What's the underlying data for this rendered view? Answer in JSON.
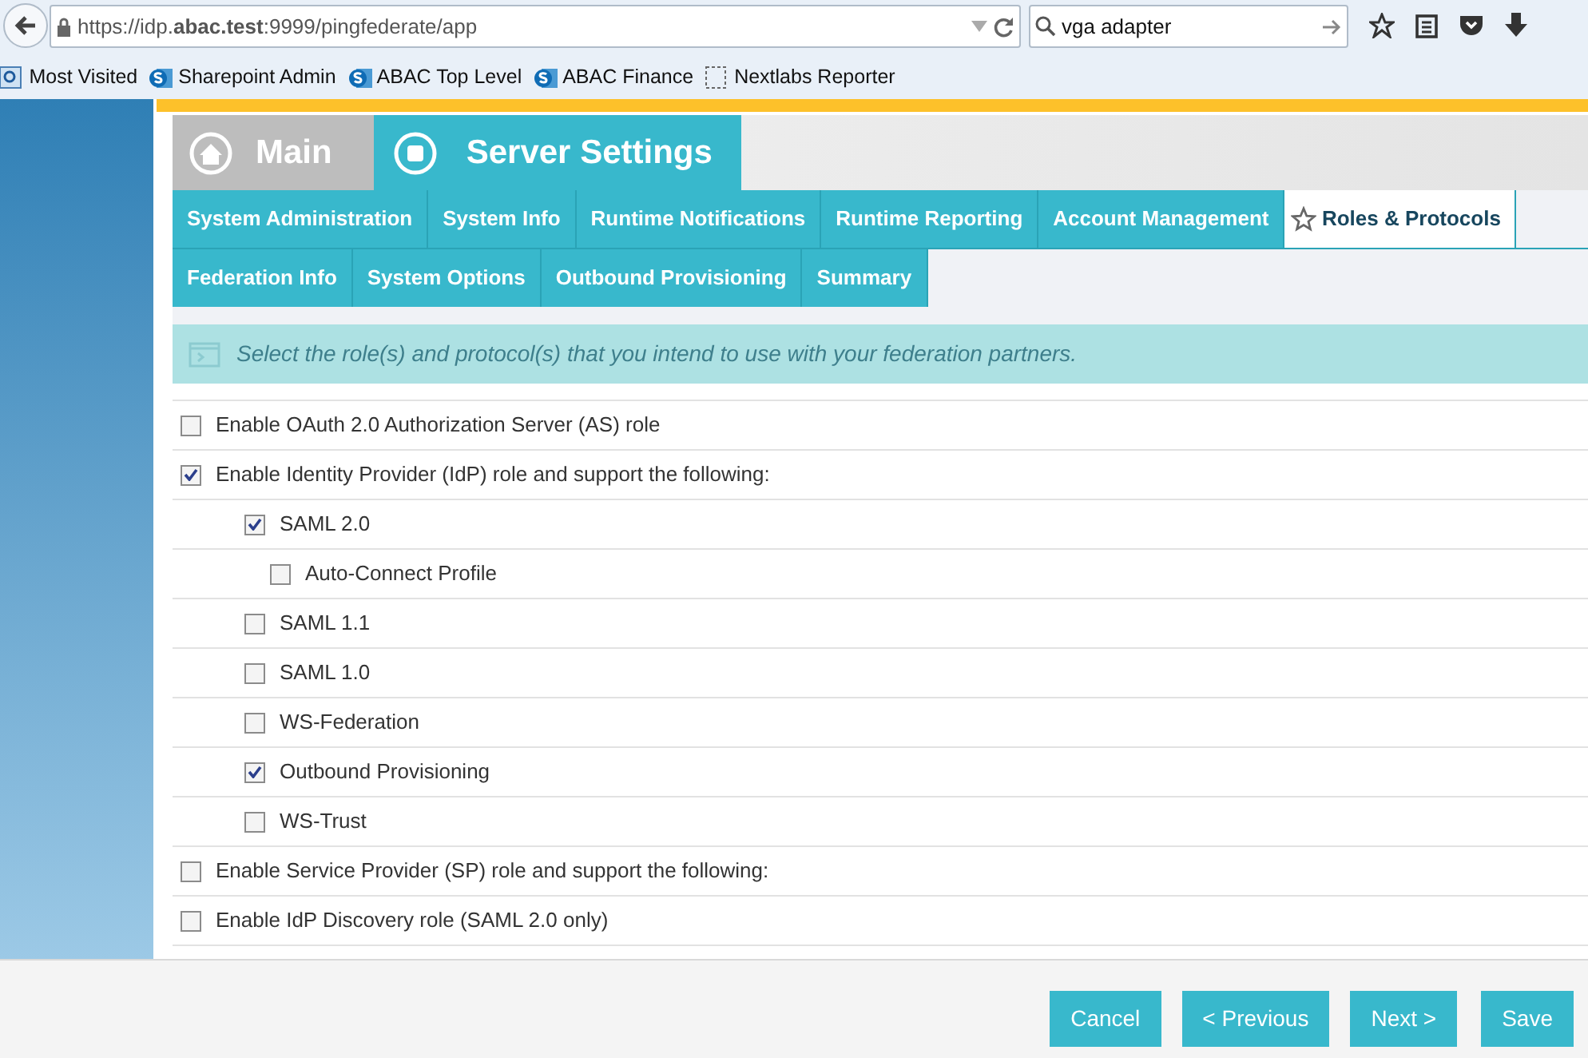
{
  "browser": {
    "url": "https://idp.**abac.test**:9999/pingfederate/app",
    "search": "vga adapter"
  },
  "bookmarks": [
    {
      "label": "Most Visited",
      "kind": "folder"
    },
    {
      "label": "Sharepoint Admin",
      "kind": "sharepoint"
    },
    {
      "label": "ABAC Top Level",
      "kind": "sharepoint"
    },
    {
      "label": "ABAC Finance",
      "kind": "sharepoint"
    },
    {
      "label": "Nextlabs Reporter",
      "kind": "blank"
    }
  ],
  "main_tabs": [
    {
      "label": "Main",
      "kind": "home",
      "selected": false
    },
    {
      "label": "Server Settings",
      "kind": "stop",
      "selected": true
    }
  ],
  "sub_tabs": [
    [
      {
        "label": "System Administration",
        "selected": false
      },
      {
        "label": "System Info",
        "selected": false
      },
      {
        "label": "Runtime Notifications",
        "selected": false
      },
      {
        "label": "Runtime Reporting",
        "selected": false
      },
      {
        "label": "Account Management",
        "selected": false
      },
      {
        "label": "Roles & Protocols",
        "selected": true
      }
    ],
    [
      {
        "label": "Federation Info",
        "selected": false
      },
      {
        "label": "System Options",
        "selected": false
      },
      {
        "label": "Outbound Provisioning",
        "selected": false
      },
      {
        "label": "Summary",
        "selected": false
      }
    ]
  ],
  "info": "Select the role(s) and protocol(s) that you intend to use with your federation partners.",
  "options": [
    {
      "label": "Enable OAuth 2.0 Authorization Server (AS) role",
      "checked": false
    },
    {
      "label": "Enable Identity Provider (IdP) role and support the following:",
      "checked": true,
      "children": [
        {
          "label": "SAML 2.0",
          "checked": true,
          "children": [
            {
              "label": "Auto-Connect Profile",
              "checked": false
            }
          ]
        },
        {
          "label": "SAML 1.1",
          "checked": false
        },
        {
          "label": "SAML 1.0",
          "checked": false
        },
        {
          "label": "WS-Federation",
          "checked": false
        },
        {
          "label": "Outbound Provisioning",
          "checked": true
        },
        {
          "label": "WS-Trust",
          "checked": false
        }
      ]
    },
    {
      "label": "Enable Service Provider (SP) role and support the following:",
      "checked": false
    },
    {
      "label": "Enable IdP Discovery role (SAML 2.0 only)",
      "checked": false
    }
  ],
  "buttons": [
    "Cancel",
    "< Previous",
    "Next >",
    "Save"
  ]
}
